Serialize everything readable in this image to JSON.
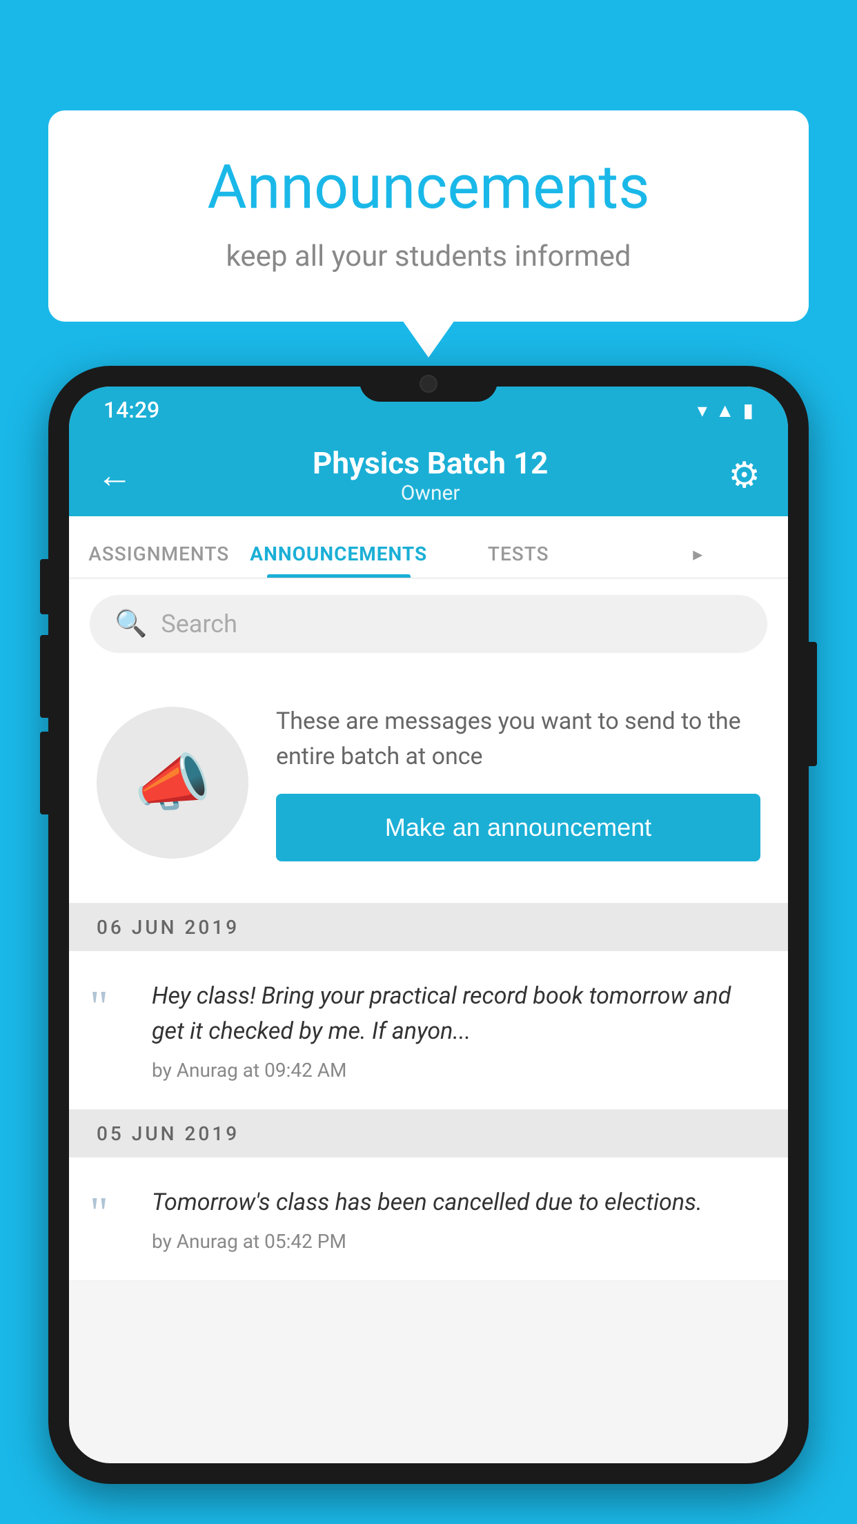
{
  "background_color": "#1ab8e8",
  "speech_bubble": {
    "title": "Announcements",
    "subtitle": "keep all your students informed"
  },
  "phone": {
    "status_bar": {
      "time": "14:29",
      "wifi": "▾",
      "signal": "▲",
      "battery": "▮"
    },
    "header": {
      "title": "Physics Batch 12",
      "subtitle": "Owner",
      "back_label": "←",
      "settings_label": "⚙"
    },
    "tabs": [
      {
        "label": "ASSIGNMENTS",
        "active": false
      },
      {
        "label": "ANNOUNCEMENTS",
        "active": true
      },
      {
        "label": "TESTS",
        "active": false
      },
      {
        "label": "▸",
        "active": false
      }
    ],
    "search": {
      "placeholder": "Search"
    },
    "promo": {
      "description": "These are messages you want to send to the entire batch at once",
      "button_label": "Make an announcement"
    },
    "announcements": [
      {
        "date": "06  JUN  2019",
        "text": "Hey class! Bring your practical record book tomorrow and get it checked by me. If anyon...",
        "meta": "by Anurag at 09:42 AM"
      },
      {
        "date": "05  JUN  2019",
        "text": "Tomorrow's class has been cancelled due to elections.",
        "meta": "by Anurag at 05:42 PM"
      }
    ]
  }
}
